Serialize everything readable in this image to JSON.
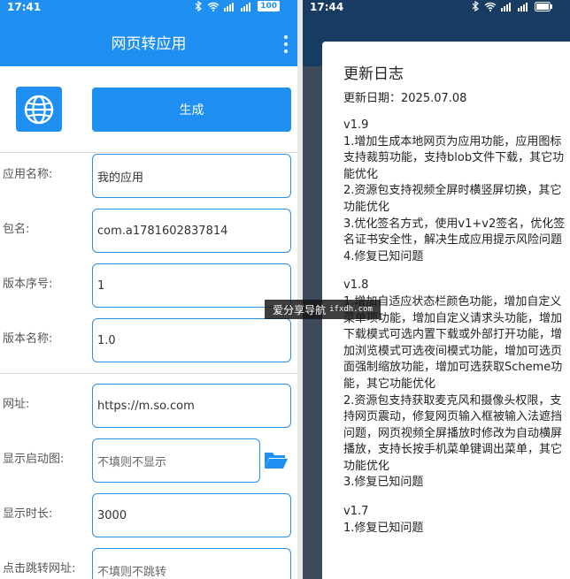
{
  "left": {
    "status": {
      "time": "17:41",
      "battery": "100"
    },
    "appbar": {
      "title": "网页转应用"
    },
    "generate_label": "生成",
    "rows": [
      {
        "label": "应用名称:",
        "value": "我的应用"
      },
      {
        "label": "包名:",
        "value": "com.a1781602837814"
      },
      {
        "label": "版本序号:",
        "value": "1"
      },
      {
        "label": "版本名称:",
        "value": "1.0"
      },
      {
        "label": "网址:",
        "value": "https://m.so.com"
      },
      {
        "label": "显示启动图:",
        "placeholder": "不填则不显示"
      },
      {
        "label": "显示时长:",
        "value": "3000"
      },
      {
        "label": "点击跳转网址:",
        "placeholder": "不填则不跳转"
      }
    ]
  },
  "right": {
    "status": {
      "time": "17:44"
    },
    "dialog": {
      "title": "更新日志",
      "date": "更新日期：2025.07.08",
      "versions": [
        {
          "name": "v1.9",
          "items": [
            "1.增加生成本地网页为应用功能，应用图标支持裁剪功能，支持blob文件下载，其它功能优化",
            "2.资源包支持视频全屏时横竖屏切换，其它功能优化",
            "3.优化签名方式，使用v1+v2签名，优化签名证书安全性，解决生成应用提示风险问题",
            "4.修复已知问题"
          ]
        },
        {
          "name": "v1.8",
          "items": [
            "1.增加自适应状态栏颜色功能，增加自定义菜单项功能，增加自定义请求头功能，增加下载模式可选内置下载或外部打开功能，增加浏览模式可选夜间模式功能，增加可选页面强制缩放功能，增加可选获取Scheme功能，其它功能优化",
            "2.资源包支持获取麦克风和摄像头权限，支持网页震动，修复网页输入框被输入法遮挡问题，网页视频全屏播放时修改为自动横屏播放，支持长按手机菜单键调出菜单，其它功能优化",
            "3.修复已知问题"
          ]
        },
        {
          "name": "v1.7",
          "items": [
            "1.修复已知问题"
          ]
        }
      ]
    }
  },
  "watermark": {
    "cn": "爱分享导航",
    "en": "ifxdh.com"
  },
  "colors": {
    "primary": "#1f8ff2",
    "field_border": "#2b8fe8",
    "dim_bg": "#3d4a5c"
  }
}
